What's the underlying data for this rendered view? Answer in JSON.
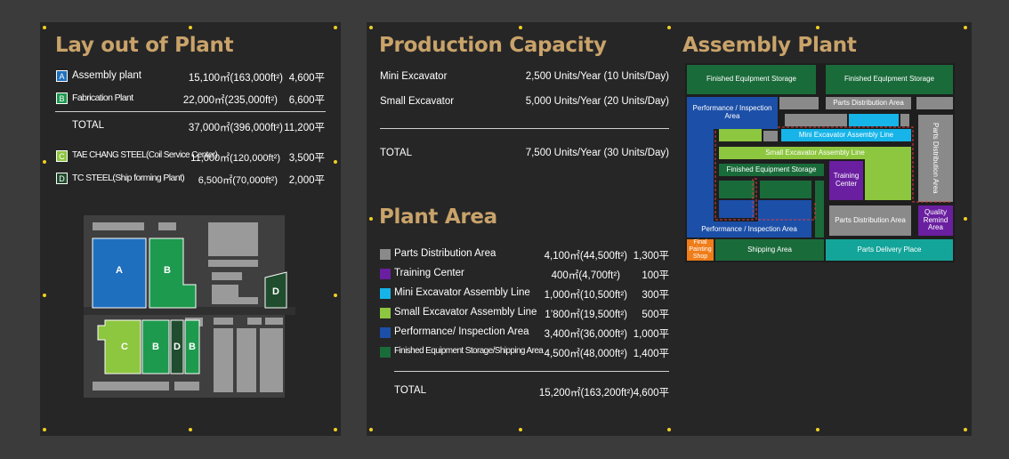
{
  "layout_panel": {
    "title": "Lay out of Plant",
    "rows": [
      {
        "badge": "A",
        "name": "Assembly plant",
        "area": "15,100㎡(163,000ft²)",
        "pyeong": "4,600平",
        "color": "#1f6fbf"
      },
      {
        "badge": "B",
        "name": "Fabrication Plant",
        "area": "22,000㎡(235,000ft²)",
        "pyeong": "6,600平",
        "color": "#1d9a4e"
      }
    ],
    "total": {
      "label": "TOTAL",
      "area": "37,000㎡(396,000ft²)",
      "pyeong": "11,200平"
    },
    "other_rows": [
      {
        "badge": "C",
        "name": "TAE CHANG STEEL(Coil Service Center)",
        "area": "11,000㎡(120,000ft²)",
        "pyeong": "3,500平",
        "color": "#8dc63f"
      },
      {
        "badge": "D",
        "name": "TC STEEL(Ship forming Plant)",
        "area": "6,500㎡(70,000ft²)",
        "pyeong": "2,000平",
        "color": "#1f4d2e"
      }
    ],
    "map_labels": {
      "a": "A",
      "b": "B",
      "b2": "B",
      "b3": "B",
      "c": "C",
      "d": "D",
      "d2": "D"
    }
  },
  "capacity_panel": {
    "title": "Production Capacity",
    "rows": [
      {
        "name": "Mini Excavator",
        "value": "2,500 Units/Year (10 Units/Day)"
      },
      {
        "name": "Small Excavator",
        "value": "5,000 Units/Year (20 Units/Day)"
      }
    ],
    "total": {
      "label": "TOTAL",
      "value": "7,500 Units/Year (30 Units/Day)"
    }
  },
  "area_panel": {
    "title": "Plant Area",
    "rows": [
      {
        "name": "Parts Distribution Area",
        "area": "4,100㎡(44,500ft²)",
        "pyeong": "1,300平",
        "color": "#8a8a8a"
      },
      {
        "name": "Training Center",
        "area": "400㎡(4,700ft²)",
        "pyeong": "100平",
        "color": "#6a1fa0"
      },
      {
        "name": "Mini Excavator Assembly Line",
        "area": "1,000㎡(10,500ft²)",
        "pyeong": "300平",
        "color": "#16b4e8"
      },
      {
        "name": "Small Excavator Assembly Line",
        "area": "1’800㎡(19,500ft²)",
        "pyeong": "500平",
        "color": "#8dc63f"
      },
      {
        "name": "Performance/ Inspection Area",
        "area": "3,400㎡(36,000ft²)",
        "pyeong": "1,000平",
        "color": "#1c4fa8"
      },
      {
        "name": "Finished Equipment Storage/Shipping Area",
        "area": "4,500㎡(48,000ft²)",
        "pyeong": "1,400平",
        "color": "#1a6b3a"
      }
    ],
    "total": {
      "label": "TOTAL",
      "area": "15,200㎡(163,200ft²)",
      "pyeong": "4,600平"
    }
  },
  "assembly_panel": {
    "title": "Assembly Plant",
    "labels": {
      "fes_left": "Finished Equlpment Storage",
      "fes_right": "Finished Equlpment Storage",
      "parts_top": "Parts Distribution Area",
      "perf_top": "Performance / Inspection Area",
      "mini_line": "Mini Excavator Assembly Line",
      "parts_vertical": "Parts Distribution Area",
      "small_line": "Small Excavator Assembly Line",
      "fes_mid": "Finished Equipment Storage",
      "training": "Training Center",
      "perf_bottom": "Performance / Inspection Area",
      "parts_mid": "Parts Distribution Area",
      "quality": "Quality Remind Area",
      "final_paint": "Final Painting Shop",
      "shipping": "Shipping Area",
      "delivery": "Parts Delivery Place"
    }
  }
}
